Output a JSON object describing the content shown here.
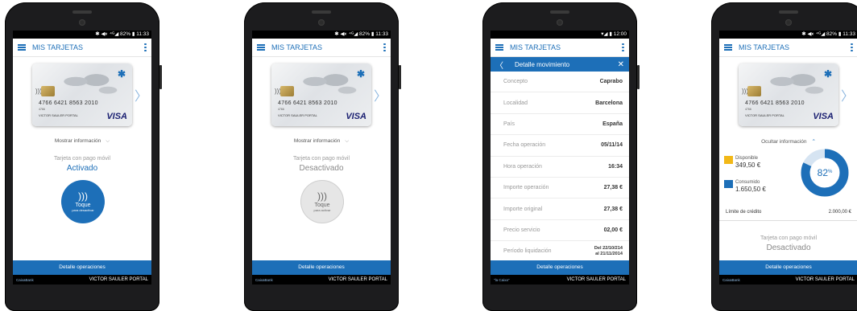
{
  "status_bar": "✱ ◀◐ ⁴ᴳ◢ 82% ▮ 11:33",
  "status_bar_3": "▾◢ ▮ 12:00",
  "app_title": "MIS TARJETAS",
  "card": {
    "number": "4766 6421 8563 2010",
    "holder": "VICTOR SAULER PORTAL",
    "brand": "VISA",
    "issuer_mark": "✱",
    "small_text": "4766"
  },
  "show_info": "Mostrar información",
  "hide_info": "Ocultar información",
  "pay_label": "Tarjeta con pago móvil",
  "state_active": "Activado",
  "state_inactive": "Desactivado",
  "tap_label": "Toque",
  "tap_sub_deactivate": "para desactivar",
  "tap_sub_activate": "para activar",
  "details_button": "Detalle operaciones",
  "footer_name": "VICTOR SAULER PORTAL",
  "footer_brand": "CaixaBank",
  "footer_brand_3": "\"la Caixa\"",
  "detail": {
    "title": "Detalle movimiento",
    "rows": [
      {
        "label": "Concepto",
        "value": "Caprabo"
      },
      {
        "label": "Localidad",
        "value": "Barcelona"
      },
      {
        "label": "País",
        "value": "España"
      },
      {
        "label": "Fecha operación",
        "value": "05/11/14"
      },
      {
        "label": "Hora operación",
        "value": "16:34"
      },
      {
        "label": "Importe operación",
        "value": "27,38 €"
      },
      {
        "label": "Importe original",
        "value": "27,38 €"
      },
      {
        "label": "Precio servicio",
        "value": "02,00 €"
      },
      {
        "label": "Período liquidación",
        "value": "Del 22/10/214",
        "value2": "al 21/11/2014"
      }
    ]
  },
  "credit": {
    "available_label": "Disponible",
    "available_value": "349,50 €",
    "consumed_label": "Consumido",
    "consumed_value": "1.650,50 €",
    "percent": "82",
    "percent_sign": "%",
    "percent_value": 82,
    "limit_label": "Límite de crédito",
    "limit_value": "2.000,00 €"
  },
  "colors": {
    "primary": "#1d6fb8",
    "available": "#f2b817",
    "inactive": "#e6e6e6"
  }
}
